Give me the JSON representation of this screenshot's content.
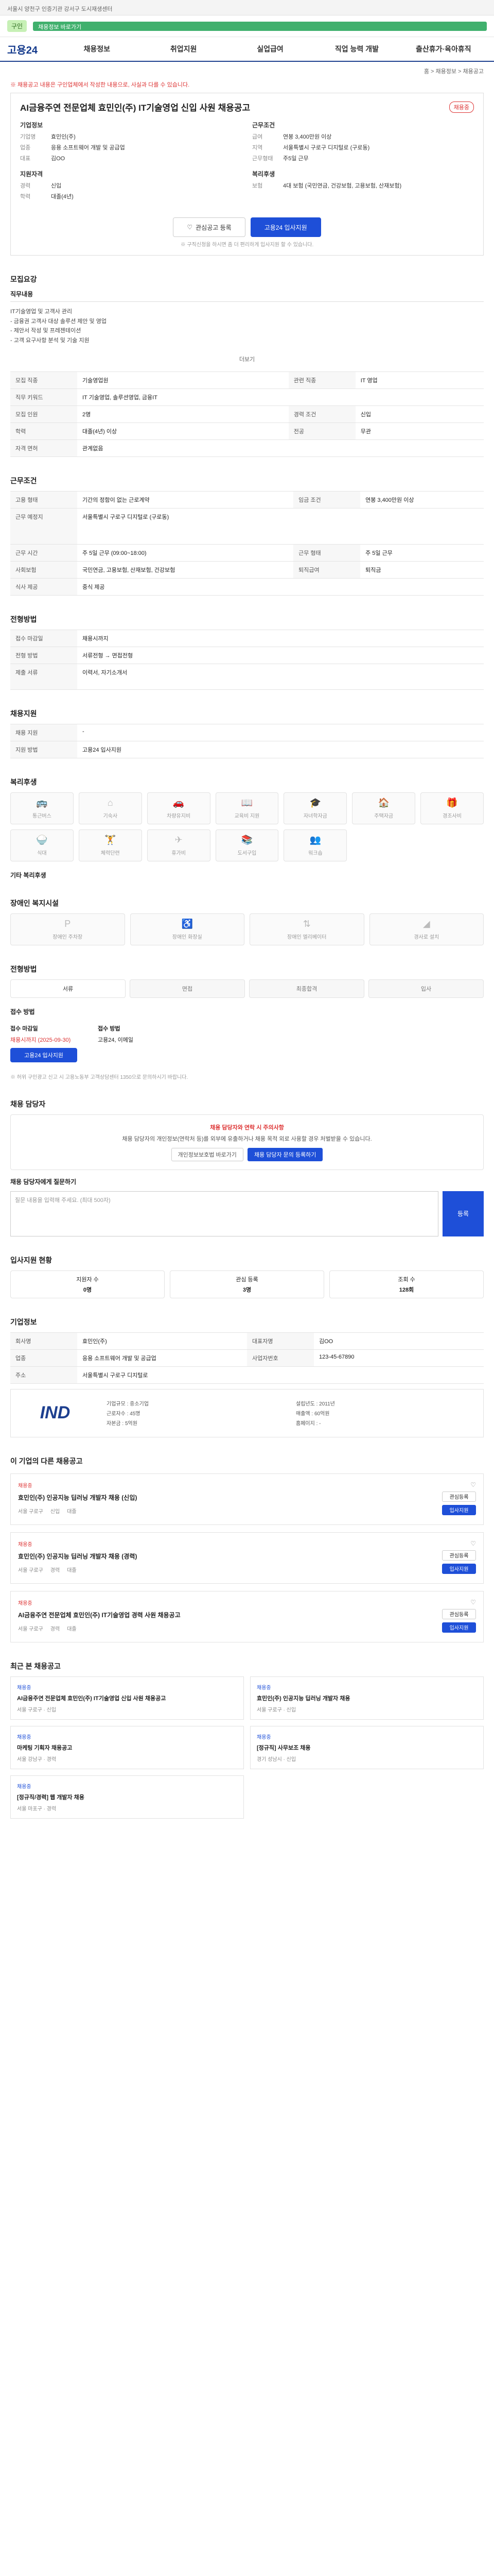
{
  "topline": {
    "text": "서울시 양천구 인증기관 강서구 도시재생센터"
  },
  "banner": {
    "tag": "구인",
    "bar_text": "채용정보 바로가기"
  },
  "gnb": {
    "logo": "고용24",
    "items": [
      "채용정보",
      "취업지원",
      "실업급여",
      "직업 능력 개발",
      "출산휴가·육아휴직"
    ]
  },
  "breadcrumb": "홈 > 채용정보 > 채용공고",
  "notice": "※ 채용공고 내용은 구인업체에서 작성한 내용으로, 사실과 다를 수 있습니다.",
  "posting": {
    "title": "AI금융주연 전문업체 효민인(주) IT기술영업 신입 사원 채용공고",
    "badge": "채용중",
    "company_header": "기업정보",
    "company_rows": [
      {
        "k": "기업명",
        "v": "효민인(주)"
      },
      {
        "k": "업종",
        "v": "응용 소프트웨어 개발 및 공급업"
      },
      {
        "k": "대표",
        "v": "김OO"
      }
    ],
    "cond_header": "근무조건",
    "cond_rows": [
      {
        "k": "급여",
        "v": "연봉 3,400만원 이상"
      },
      {
        "k": "지역",
        "v": "서울특별시 구로구 디지털로 (구로동)"
      },
      {
        "k": "근무형태",
        "v": "주5일 근무"
      }
    ],
    "extra_header": "지원자격",
    "extra_rows": [
      {
        "k": "경력",
        "v": "신입"
      },
      {
        "k": "학력",
        "v": "대졸(4년)"
      }
    ],
    "extra2_header": "복리후생",
    "extra2_rows": [
      {
        "k": "보험",
        "v": "4대 보험 (국민연금, 건강보험, 고용보험, 산재보험)"
      }
    ],
    "scrap_btn": "관심공고 등록",
    "apply_btn": "고용24 입사지원",
    "apply_note": "※ 구직신청을 하시면 좀 더 편리하게 입사지원 할 수 있습니다."
  },
  "sections": {
    "job_detail": "모집요강",
    "job_detail_sub": "직무내용",
    "job_detail_text": "IT기술영업 및 고객사 관리\n- 금융권 고객사 대상 솔루션 제안 및 영업\n- 제안서 작성 및 프레젠테이션\n- 고객 요구사항 분석 및 기술 지원",
    "more": "더보기",
    "table1": [
      [
        "모집 직종",
        "기술영업원",
        "관련 직종",
        "IT 영업"
      ],
      [
        "직무 키워드",
        "IT 기술영업, 솔루션영업, 금융IT",
        "",
        ""
      ],
      [
        "모집 인원",
        "2명",
        "경력 조건",
        "신입"
      ],
      [
        "학력",
        "대졸(4년) 이상",
        "전공",
        "무관"
      ],
      [
        "자격 면허",
        "관계없음",
        "",
        ""
      ]
    ],
    "work_cond": "근무조건",
    "table2": [
      [
        "고용 형태",
        "기간의 정함이 없는 근로계약",
        "임금 조건",
        "연봉 3,400만원 이상"
      ],
      [
        "근무 예정지",
        "서울특별시 구로구 디지털로 (구로동)",
        "",
        ""
      ],
      [
        "근무 시간",
        "주 5일 근무 (09:00~18:00)",
        "근무 형태",
        "주 5일 근무"
      ],
      [
        "사회보험",
        "국민연금, 고용보험, 산재보험, 건강보험",
        "퇴직급여",
        "퇴직금"
      ],
      [
        "식사 제공",
        "중식 제공",
        "",
        ""
      ]
    ],
    "apply_method": "전형방법",
    "apply_rows": [
      [
        "접수 마감일",
        "채용시까지"
      ],
      [
        "전형 방법",
        "서류전형 → 면접전형"
      ],
      [
        "제출 서류",
        "이력서, 자기소개서"
      ]
    ],
    "welfare": "복리후생",
    "welfare_items": [
      "통근버스",
      "기숙사",
      "차량유지비",
      "교육비 지원",
      "자녀학자금",
      "주택자금",
      "경조사비",
      "식대",
      "체력단련",
      "휴가비",
      "도서구입",
      "워크숍"
    ],
    "welfare_note": "기타 복리후생",
    "disability": "장애인 복지시설",
    "disability_items": [
      "장애인 주차장",
      "장애인 화장실",
      "장애인 엘리베이터",
      "경사로 설치"
    ],
    "support": "채용지원",
    "support_rows": [
      [
        "채용 지원",
        "-"
      ],
      [
        "지원 방법",
        "고용24 입사지원"
      ]
    ],
    "process": "전형방법",
    "process_steps": [
      "서류",
      "면접",
      "최종합격",
      "입사"
    ],
    "apply_title": "접수 방법",
    "apply_date_label": "접수 마감일",
    "apply_date": "채용시까지 (2025-09-30)",
    "apply_btn": "고용24 입사지원",
    "apply_way_label": "접수 방법",
    "apply_way": "고용24, 이메일",
    "notes": "※ 허위 구인광고 신고 시 고용노동부 고객상담센터 1350으로 문의하시기 바랍니다.",
    "contact": "채용 담당자",
    "contact_alert": "채용 담당자와 연락 시 주의사항",
    "contact_text": "채용 담당자의 개인정보(연락처 등)를 외부에 유출하거나 채용 목적 외로 사용할 경우 처벌받을 수 있습니다.",
    "contact_btn1": "개인정보보호법 바로가기",
    "contact_btn2": "채용 담당자 문의 등록하기",
    "textarea_label": "채용 담당자에게 질문하기",
    "textarea_ph": "질문 내용을 입력해 주세요. (최대 500자)",
    "send": "등록",
    "interest": "입사지원 현황",
    "interest_boxes": [
      [
        "지원자 수",
        "0명"
      ],
      [
        "관심 등록",
        "3명"
      ],
      [
        "조회 수",
        "128회"
      ]
    ],
    "company_info": "기업정보",
    "info_grid": [
      [
        "회사명",
        "효민인(주)",
        "대표자명",
        "김OO"
      ],
      [
        "업종",
        "응용 소프트웨어 개발 및 공급업",
        "사업자번호",
        "123-45-67890"
      ],
      [
        "주소",
        "서울특별시 구로구 디지털로",
        "",
        ""
      ]
    ],
    "company_logo": "IND",
    "company_detail": [
      [
        "기업규모",
        "중소기업"
      ],
      [
        "설립년도",
        "2011년"
      ],
      [
        "근로자수",
        "45명"
      ],
      [
        "매출액",
        "60억원"
      ],
      [
        "자본금",
        "5억원"
      ],
      [
        "홈페이지",
        "-"
      ]
    ],
    "others": "이 기업의 다른 채용공고",
    "other_jobs": [
      {
        "tag": "채용중",
        "name": "효민인(주) 인공지능 딥러닝 개발자 채용 (신입)",
        "meta": [
          "서울 구로구",
          "신입",
          "대졸"
        ],
        "b1": "관심등록",
        "b2": "입사지원"
      },
      {
        "tag": "채용중",
        "name": "효민인(주) 인공지능 딥러닝 개발자 채용 (경력)",
        "meta": [
          "서울 구로구",
          "경력",
          "대졸"
        ],
        "b1": "관심등록",
        "b2": "입사지원"
      },
      {
        "tag": "채용중",
        "name": "AI금융주연 전문업체 효민인(주) IT기술영업 경력 사원 채용공고",
        "meta": [
          "서울 구로구",
          "경력",
          "대졸"
        ],
        "b1": "관심등록",
        "b2": "입사지원"
      }
    ],
    "recent": "최근 본 채용공고",
    "recent_jobs": [
      {
        "tags": "채용중",
        "name": "AI금융주연 전문업체 효민인(주) IT기술영업 신입 사원 채용공고",
        "meta": "서울 구로구 · 신입"
      },
      {
        "tags": "채용중",
        "name": "효민인(주) 인공지능 딥러닝 개발자 채용",
        "meta": "서울 구로구 · 신입"
      },
      {
        "tags": "채용중",
        "name": "마케팅 기획자 채용공고",
        "meta": "서울 강남구 · 경력"
      },
      {
        "tags": "채용중",
        "name": "[정규직] 사무보조 채용",
        "meta": "경기 성남시 · 신입"
      },
      {
        "tags": "채용중",
        "name": "[정규직/경력] 웹 개발자 채용",
        "meta": "서울 마포구 · 경력"
      }
    ]
  }
}
